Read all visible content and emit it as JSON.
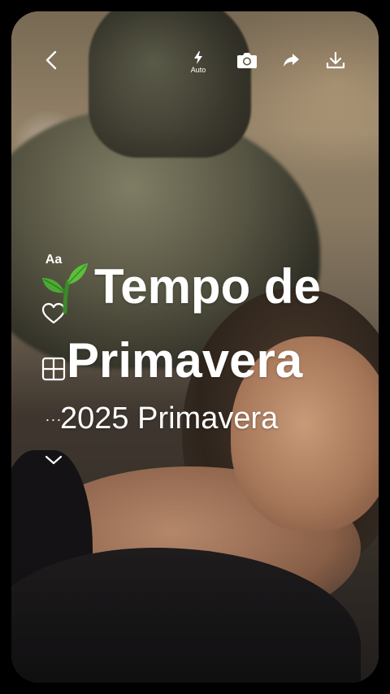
{
  "toolbar": {
    "flash_label": "Auto",
    "icons": [
      "chevron-left-icon",
      "flash-icon",
      "camera-icon",
      "share-icon",
      "download-icon"
    ]
  },
  "side_tools": {
    "text_tool_label": "Aa",
    "more_label": "···",
    "icons": [
      "heart-icon",
      "layout-icon",
      "chevron-down-icon"
    ]
  },
  "title": {
    "line1": "Tempo de",
    "line2": "Primavera",
    "emoji_icon": "sprout-icon"
  },
  "subtitle": "2025 Primavera",
  "colors": {
    "text": "#ffffff",
    "background": "#000000"
  }
}
